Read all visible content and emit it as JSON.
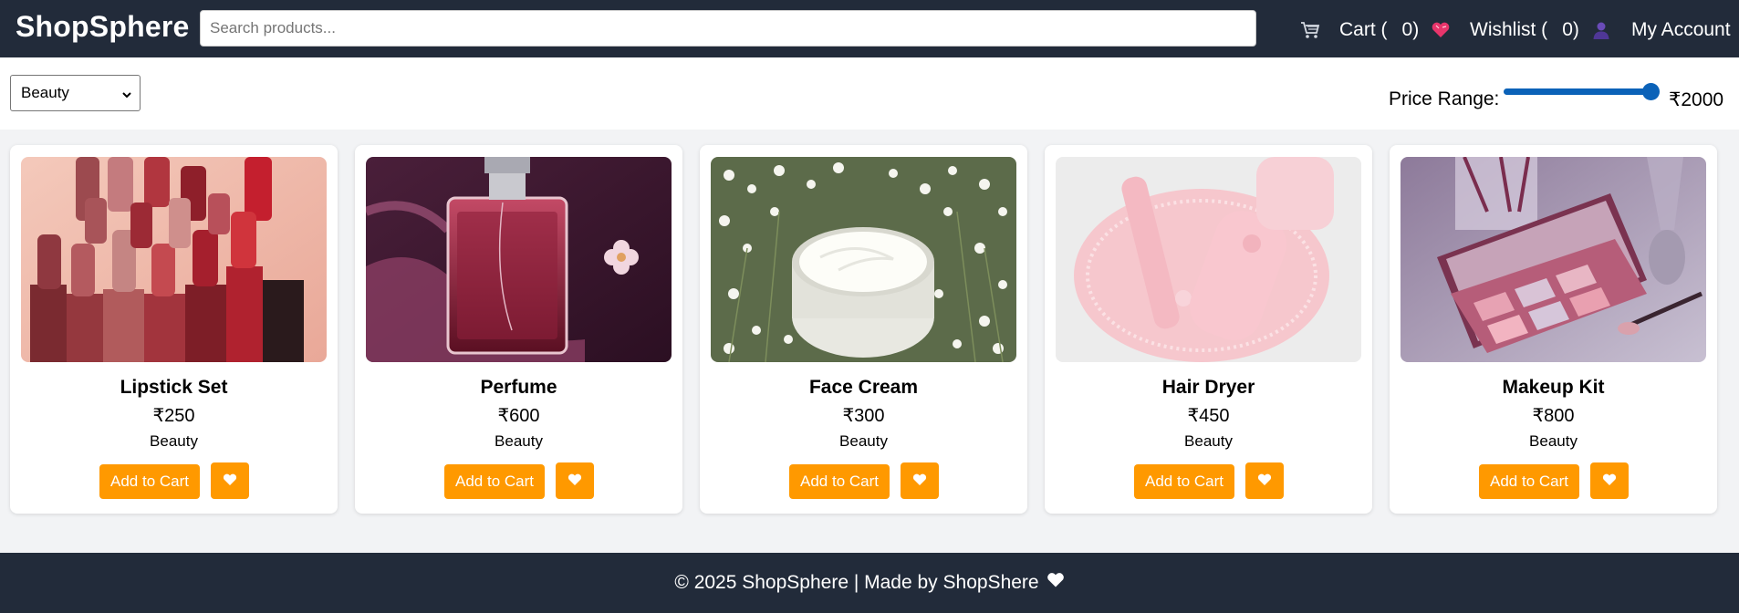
{
  "header": {
    "brand": "ShopSphere",
    "search_placeholder": "Search products...",
    "cart_label": "Cart (",
    "cart_count": "0)",
    "wishlist_label": "Wishlist (",
    "wishlist_count": "0)",
    "account_label": "My Account"
  },
  "filters": {
    "category_selected": "Beauty",
    "price_label": "Price Range:",
    "price_value": "₹2000",
    "price_slider_fraction": 0.95
  },
  "products": [
    {
      "name": "Lipstick Set",
      "price": "₹250",
      "category": "Beauty",
      "add_to_cart": "Add to Cart",
      "image": "lipstick-set-photo"
    },
    {
      "name": "Perfume",
      "price": "₹600",
      "category": "Beauty",
      "add_to_cart": "Add to Cart",
      "image": "perfume-bottle-photo"
    },
    {
      "name": "Face Cream",
      "price": "₹300",
      "category": "Beauty",
      "add_to_cart": "Add to Cart",
      "image": "face-cream-jar-photo"
    },
    {
      "name": "Hair Dryer",
      "price": "₹450",
      "category": "Beauty",
      "add_to_cart": "Add to Cart",
      "image": "hair-dryer-photo"
    },
    {
      "name": "Makeup Kit",
      "price": "₹800",
      "category": "Beauty",
      "add_to_cart": "Add to Cart",
      "image": "makeup-kit-photo"
    }
  ],
  "footer": {
    "text": "© 2025 ShopSphere | Made by ShopShere"
  },
  "colors": {
    "nav_bg": "#222b3a",
    "accent_orange": "#ff9900",
    "slider_blue": "#0b62b8",
    "page_bg": "#f2f3f5"
  },
  "icons": [
    "cart-icon",
    "heart-icon",
    "user-icon",
    "chevron-down-icon",
    "white-heart-icon"
  ]
}
